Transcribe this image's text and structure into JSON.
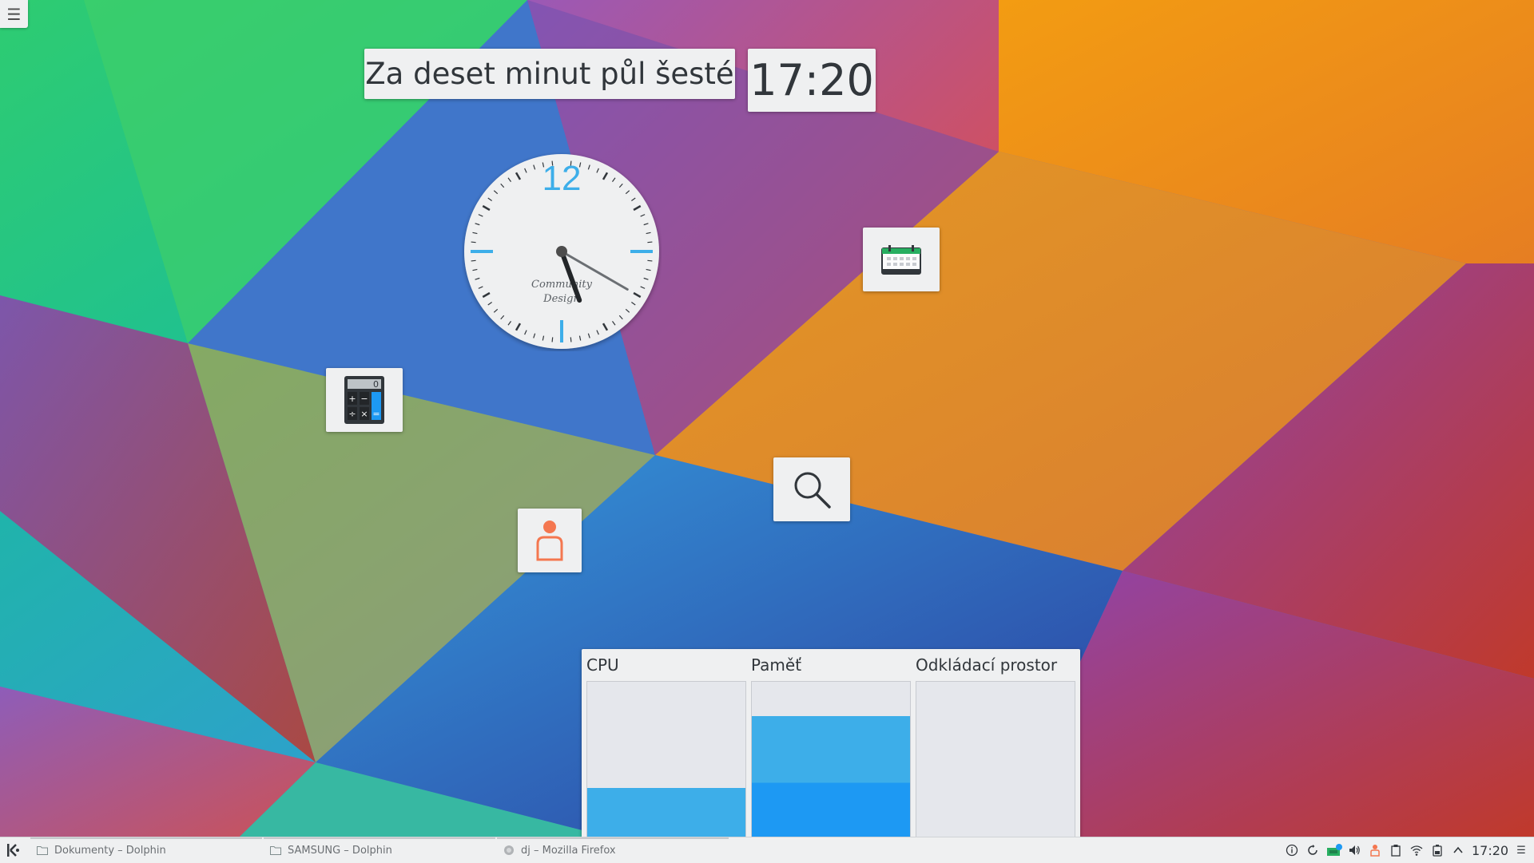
{
  "desktop": {
    "toolbox_icon": "hamburger-menu-icon"
  },
  "fuzzy_clock": {
    "text": "Za deset minut půl šesté"
  },
  "digital_clock": {
    "time": "17:20"
  },
  "analog_clock": {
    "numeral_12": "12",
    "brand_line1": "Community",
    "brand_line2": "Design",
    "hour_hand_angle": 160,
    "minute_hand_angle": 120,
    "accent": "#3daee9"
  },
  "widgets": {
    "calendar_icon": "calendar-icon",
    "calculator_icon": "calculator-icon",
    "calculator_display": "0",
    "search_icon": "search-icon",
    "user_icon": "user-icon"
  },
  "system_monitor": {
    "columns": [
      {
        "title": "CPU",
        "fill_fraction": 0.32,
        "colors": [
          "#3daee9"
        ]
      },
      {
        "title": "Paměť",
        "fill_fraction": 0.78,
        "colors": [
          "#3daee9",
          "#1d99f3"
        ]
      },
      {
        "title": "Odkládací prostor",
        "fill_fraction": 0.0,
        "colors": []
      }
    ]
  },
  "taskbar": {
    "launcher_icon": "kde-logo-icon",
    "tasks": [
      {
        "label": "Dokumenty – Dolphin",
        "icon": "folder-icon"
      },
      {
        "label": "SAMSUNG – Dolphin",
        "icon": "folder-icon"
      },
      {
        "label": "dj – Mozilla Firefox",
        "icon": "firefox-icon"
      }
    ],
    "tray_icons": [
      "info-icon",
      "update-icon",
      "network-manager-icon",
      "volume-icon",
      "user-status-icon",
      "clipboard-icon",
      "wifi-icon",
      "battery-icon",
      "expand-tray-icon"
    ],
    "clock": "17:20",
    "panel_menu_icon": "panel-menu-icon"
  }
}
